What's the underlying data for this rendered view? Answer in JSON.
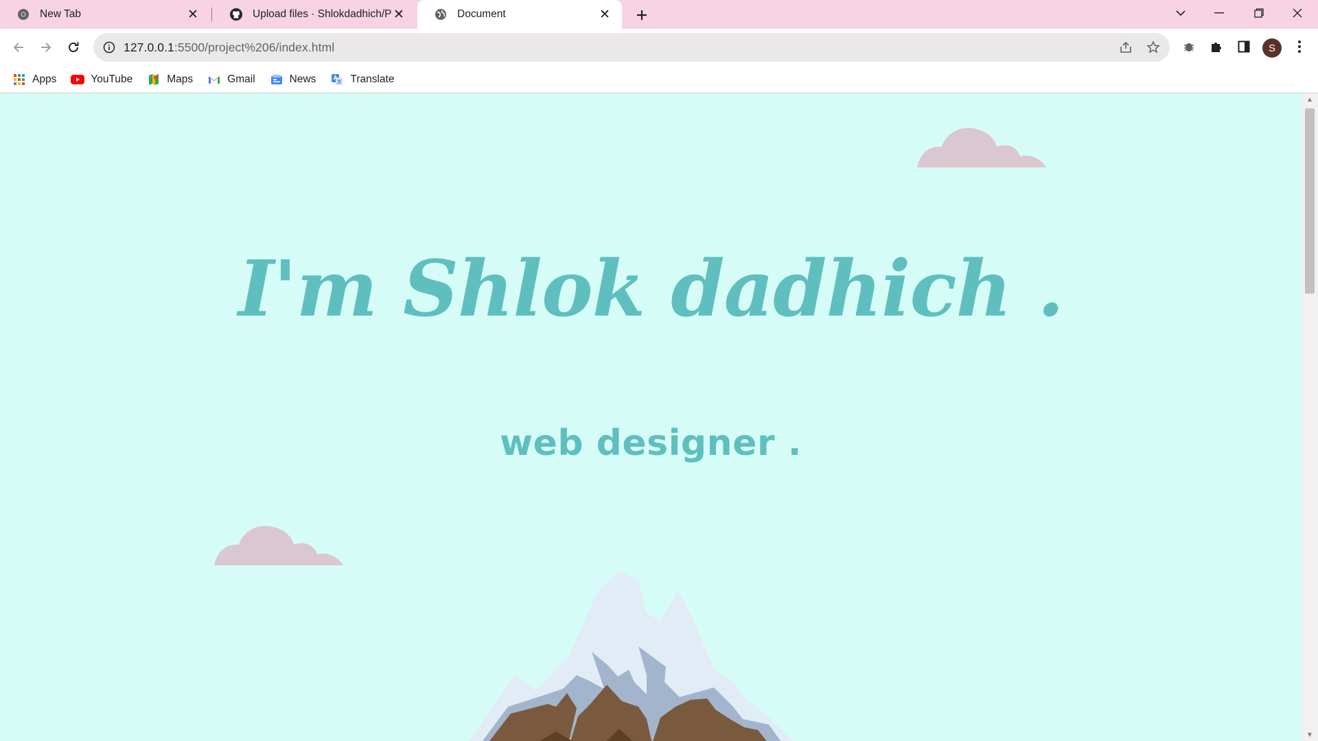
{
  "browser": {
    "tabs": [
      {
        "title": "New Tab",
        "icon": "chrome-icon",
        "active": false
      },
      {
        "title": "Upload files · Shlokdadhich/Portfolio",
        "icon": "github-icon",
        "active": false
      },
      {
        "title": "Document",
        "icon": "globe-icon",
        "active": true
      }
    ],
    "address": {
      "host": "127.0.0.1",
      "path": ":5500/project%206/index.html"
    },
    "profile_initial": "S"
  },
  "bookmarks": [
    {
      "label": "Apps",
      "icon": "apps-grid-icon"
    },
    {
      "label": "YouTube",
      "icon": "youtube-icon"
    },
    {
      "label": "Maps",
      "icon": "maps-icon"
    },
    {
      "label": "Gmail",
      "icon": "gmail-icon"
    },
    {
      "label": "News",
      "icon": "news-icon"
    },
    {
      "label": "Translate",
      "icon": "translate-icon"
    }
  ],
  "page": {
    "headline": "I'm Shlok dadhich .",
    "subtitle": "web designer ."
  },
  "colors": {
    "tabstrip": "#f7d3e3",
    "page_background": "#d6fcf8",
    "accent_text": "#5fbfbe",
    "cloud": "#dbc7cf",
    "mountain_rock": "#7a5a3e",
    "mountain_snow": "#e2ecf7",
    "mountain_shadow": "#a3b5cc"
  }
}
